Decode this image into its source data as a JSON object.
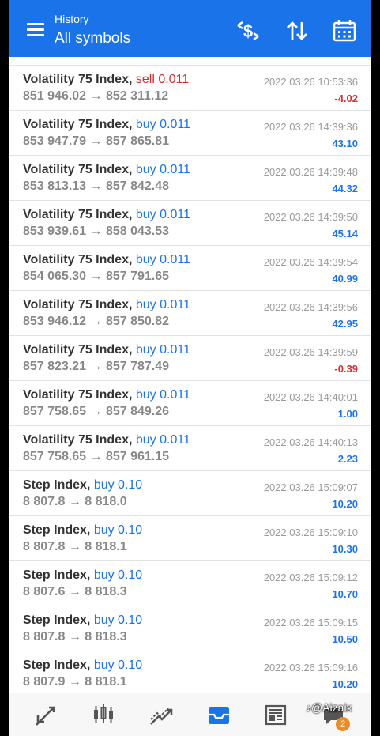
{
  "header": {
    "subtitle": "History",
    "title": "All symbols",
    "actions": [
      "currency-exchange-icon",
      "sort-icon",
      "calendar-icon"
    ]
  },
  "trades": [
    {
      "symbol": "Volatility 75 Index,",
      "side": "sell 0.011",
      "type": "sell",
      "prices": "851 946.02 → 852 311.12",
      "time": "2022.03.26 10:53:36",
      "profit": "-4.02"
    },
    {
      "symbol": "Volatility 75 Index,",
      "side": "buy 0.011",
      "type": "buy",
      "prices": "853 947.79 → 857 865.81",
      "time": "2022.03.26 14:39:36",
      "profit": "43.10"
    },
    {
      "symbol": "Volatility 75 Index,",
      "side": "buy 0.011",
      "type": "buy",
      "prices": "853 813.13 → 857 842.48",
      "time": "2022.03.26 14:39:48",
      "profit": "44.32"
    },
    {
      "symbol": "Volatility 75 Index,",
      "side": "buy 0.011",
      "type": "buy",
      "prices": "853 939.61 → 858 043.53",
      "time": "2022.03.26 14:39:50",
      "profit": "45.14"
    },
    {
      "symbol": "Volatility 75 Index,",
      "side": "buy 0.011",
      "type": "buy",
      "prices": "854 065.30 → 857 791.65",
      "time": "2022.03.26 14:39:54",
      "profit": "40.99"
    },
    {
      "symbol": "Volatility 75 Index,",
      "side": "buy 0.011",
      "type": "buy",
      "prices": "853 946.12 → 857 850.82",
      "time": "2022.03.26 14:39:56",
      "profit": "42.95"
    },
    {
      "symbol": "Volatility 75 Index,",
      "side": "buy 0.011",
      "type": "buy",
      "prices": "857 823.21 → 857 787.49",
      "time": "2022.03.26 14:39:59",
      "profit": "-0.39"
    },
    {
      "symbol": "Volatility 75 Index,",
      "side": "buy 0.011",
      "type": "buy",
      "prices": "857 758.65 → 857 849.26",
      "time": "2022.03.26 14:40:01",
      "profit": "1.00"
    },
    {
      "symbol": "Volatility 75 Index,",
      "side": "buy 0.011",
      "type": "buy",
      "prices": "857 758.65 → 857 961.15",
      "time": "2022.03.26 14:40:13",
      "profit": "2.23"
    },
    {
      "symbol": "Step Index,",
      "side": "buy 0.10",
      "type": "buy",
      "prices": "8 807.8 → 8 818.0",
      "time": "2022.03.26 15:09:07",
      "profit": "10.20"
    },
    {
      "symbol": "Step Index,",
      "side": "buy 0.10",
      "type": "buy",
      "prices": "8 807.8 → 8 818.1",
      "time": "2022.03.26 15:09:10",
      "profit": "10.30"
    },
    {
      "symbol": "Step Index,",
      "side": "buy 0.10",
      "type": "buy",
      "prices": "8 807.6 → 8 818.3",
      "time": "2022.03.26 15:09:12",
      "profit": "10.70"
    },
    {
      "symbol": "Step Index,",
      "side": "buy 0.10",
      "type": "buy",
      "prices": "8 807.8 → 8 818.3",
      "time": "2022.03.26 15:09:15",
      "profit": "10.50"
    },
    {
      "symbol": "Step Index,",
      "side": "buy 0.10",
      "type": "buy",
      "prices": "8 807.9 → 8 818.1",
      "time": "2022.03.26 15:09:16",
      "profit": "10.20"
    }
  ],
  "bottom_nav": {
    "items": [
      "quotes-icon",
      "chart-icon",
      "trade-icon",
      "history-icon",
      "news-icon",
      "messages-icon"
    ],
    "active": "history-icon",
    "messages_badge": "2"
  },
  "watermark": "♪@Aizaix",
  "colors": {
    "accent": "#1a73e8",
    "sell": "#d32f2f",
    "profit_positive": "#1a73e8",
    "profit_negative": "#d32f2f"
  }
}
